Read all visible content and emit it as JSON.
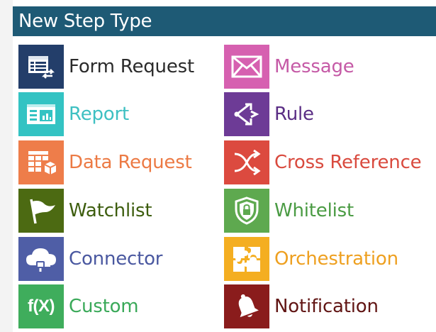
{
  "header": {
    "title": "New Step Type"
  },
  "items": [
    {
      "id": "form-request",
      "label": "Form Request",
      "icon": "form-request-icon",
      "bg": "#233e6a",
      "color": "#2b2b2b"
    },
    {
      "id": "message",
      "label": "Message",
      "icon": "envelope-icon",
      "bg": "#d660b0",
      "color": "#c55aa6"
    },
    {
      "id": "report",
      "label": "Report",
      "icon": "report-chart-icon",
      "bg": "#33c3c3",
      "color": "#3ec0c2"
    },
    {
      "id": "rule",
      "label": "Rule",
      "icon": "rule-branch-icon",
      "bg": "#6d3b96",
      "color": "#5b2e85"
    },
    {
      "id": "data-request",
      "label": "Data Request",
      "icon": "data-request-icon",
      "bg": "#ee7d4a",
      "color": "#ec7a44"
    },
    {
      "id": "cross-reference",
      "label": "Cross Reference",
      "icon": "shuffle-icon",
      "bg": "#dc4a3f",
      "color": "#d94a3e"
    },
    {
      "id": "watchlist",
      "label": "Watchlist",
      "icon": "flag-icon",
      "bg": "#4c6a12",
      "color": "#3d5d0e"
    },
    {
      "id": "whitelist",
      "label": "Whitelist",
      "icon": "shield-lock-icon",
      "bg": "#5ea94f",
      "color": "#4a9b43"
    },
    {
      "id": "connector",
      "label": "Connector",
      "icon": "cloud-plug-icon",
      "bg": "#4f5ea6",
      "color": "#4a58a0"
    },
    {
      "id": "orchestration",
      "label": "Orchestration",
      "icon": "puzzle-icon",
      "bg": "#f4ae21",
      "color": "#eea020"
    },
    {
      "id": "custom",
      "label": "Custom",
      "icon": "function-icon",
      "bg": "#3fad5c",
      "color": "#3aa959"
    },
    {
      "id": "notification",
      "label": "Notification",
      "icon": "bell-icon",
      "bg": "#8a1c1c",
      "color": "#611514"
    }
  ],
  "custom_icon_text": "f(X)"
}
